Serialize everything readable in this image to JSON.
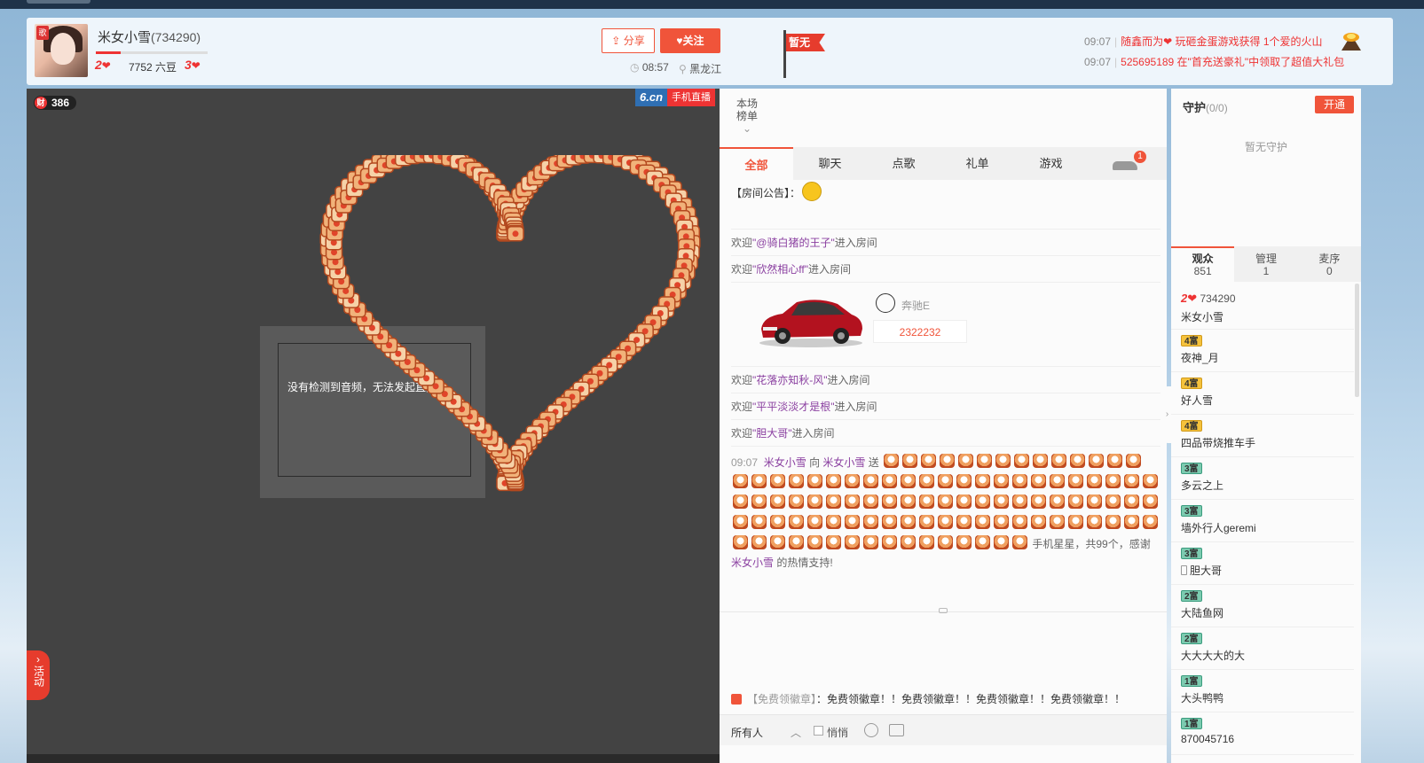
{
  "header": {
    "anchor_name": "米女小雪",
    "room_id": "(734290)",
    "avatar_badge": "歌",
    "level_left": "2",
    "beans": "7752 六豆",
    "level_right": "3",
    "level_progress": 0.22,
    "share_label": "分享",
    "follow_label": "关注",
    "time": "08:57",
    "location": "黑龙江",
    "flag_label": "暂无",
    "news": [
      {
        "time": "09:07",
        "text": "随鑫而为❤ 玩砸金蛋游戏获得 1个爱的火山"
      },
      {
        "time": "09:07",
        "text": "525695189 在\"首充送豪礼\"中领取了超值大礼包"
      }
    ]
  },
  "video": {
    "wealth_icon": "财",
    "wealth_count": "386",
    "brand": "6.cn",
    "brand_tag": "手机直播",
    "no_mic_text": "没有检测到音频，无法发起直播",
    "activity_label": "活动"
  },
  "chat": {
    "rank_label_1": "本场",
    "rank_label_2": "榜单",
    "tabs": [
      "全部",
      "聊天",
      "点歌",
      "礼单",
      "游戏"
    ],
    "car_badge": "1",
    "notice": "【房间公告】：",
    "welcome_prefix": "欢迎",
    "welcome_suffix": "进入房间",
    "welcomes_1": [
      "\"@骑白猪的王子\"",
      "\"欣然相心ff\""
    ],
    "car_name": "奔驰E",
    "car_number": "2322232",
    "welcomes_2": [
      "\"花落亦知秋-风\"",
      "\"平平淡淡才是根\"",
      "\"胆大哥\""
    ],
    "gift": {
      "time": "09:07",
      "from": "米女小雪",
      "to_word": "向",
      "to": "米女小雪",
      "send_word": "送",
      "count_icons": 99,
      "tail": "手机星星，共99个，感谢",
      "thanks_user": "米女小雪",
      "end": "的热情支持!"
    },
    "free_prefix": "【免费领徽章】",
    "free_text": "：免费领徽章！！免费领徽章！！免费领徽章！！免费领徽章！！",
    "input": {
      "to_label": "所有人",
      "quiet_label": "悄悄"
    }
  },
  "right": {
    "guard_title": "守护",
    "guard_count": "(0/0)",
    "open_label": "开通",
    "guard_empty": "暂无守护",
    "tabs": [
      {
        "label": "观众",
        "count": "851"
      },
      {
        "label": "管理",
        "count": "1"
      },
      {
        "label": "麦序",
        "count": "0"
      }
    ],
    "audience": [
      {
        "level": "2",
        "badge_type": "anchor",
        "rid": "734290",
        "name": "米女小雪"
      },
      {
        "level": "4富",
        "badge_type": "gold",
        "name": "夜神_月"
      },
      {
        "level": "4富",
        "badge_type": "gold",
        "name": "好人雪"
      },
      {
        "level": "4富",
        "badge_type": "gold",
        "name": "四品带烧推车手"
      },
      {
        "level": "3富",
        "badge_type": "teal",
        "name": "多云之上"
      },
      {
        "level": "3富",
        "badge_type": "teal",
        "name": "墙外行人geremi"
      },
      {
        "level": "3富",
        "badge_type": "teal",
        "name": "胆大哥",
        "phone": true
      },
      {
        "level": "2富",
        "badge_type": "teal",
        "name": "大陆鱼网"
      },
      {
        "level": "2富",
        "badge_type": "teal",
        "name": "大大大大的大"
      },
      {
        "level": "1富",
        "badge_type": "teal",
        "name": "大头鸭鸭"
      },
      {
        "level": "1富",
        "badge_type": "teal",
        "name": "870045716"
      }
    ]
  }
}
